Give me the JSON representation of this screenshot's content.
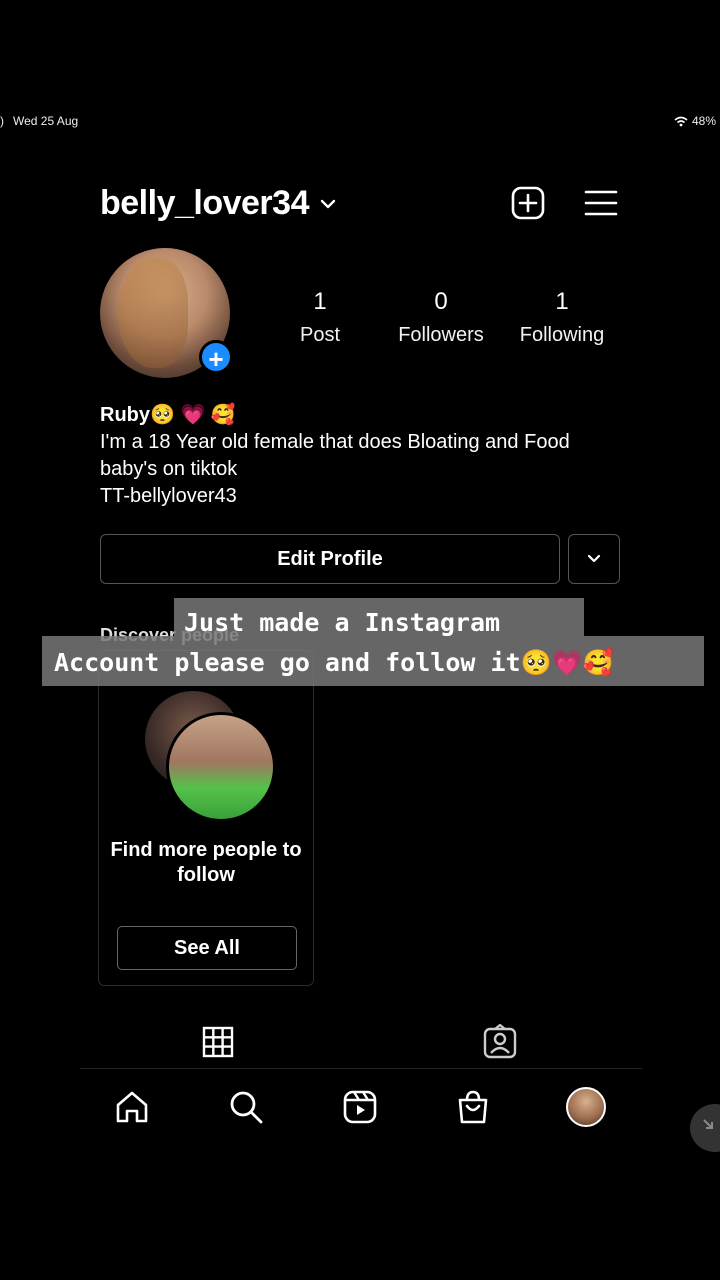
{
  "status_bar": {
    "date": "Wed 25 Aug",
    "battery": "48%"
  },
  "header": {
    "username": "belly_lover34"
  },
  "stats": [
    {
      "count": "1",
      "label": "Post"
    },
    {
      "count": "0",
      "label": "Followers"
    },
    {
      "count": "1",
      "label": "Following"
    }
  ],
  "bio": {
    "name": "Ruby🥺 💗 🥰",
    "line1": "I'm a 18 Year old female that does Bloating and Food",
    "line2": "baby's on tiktok",
    "line3": "TT-bellylover43"
  },
  "buttons": {
    "edit_profile": "Edit Profile",
    "see_all": "See All"
  },
  "discover": {
    "title": "Discover people",
    "card_text": "Find more people to follow"
  },
  "caption": {
    "line1": "Just made a Instagram",
    "line2": "Account please go and follow it🥺💗🥰"
  },
  "colors": {
    "background": "#000000",
    "accent": "#1a8cff",
    "caption_bg": "#787878"
  }
}
